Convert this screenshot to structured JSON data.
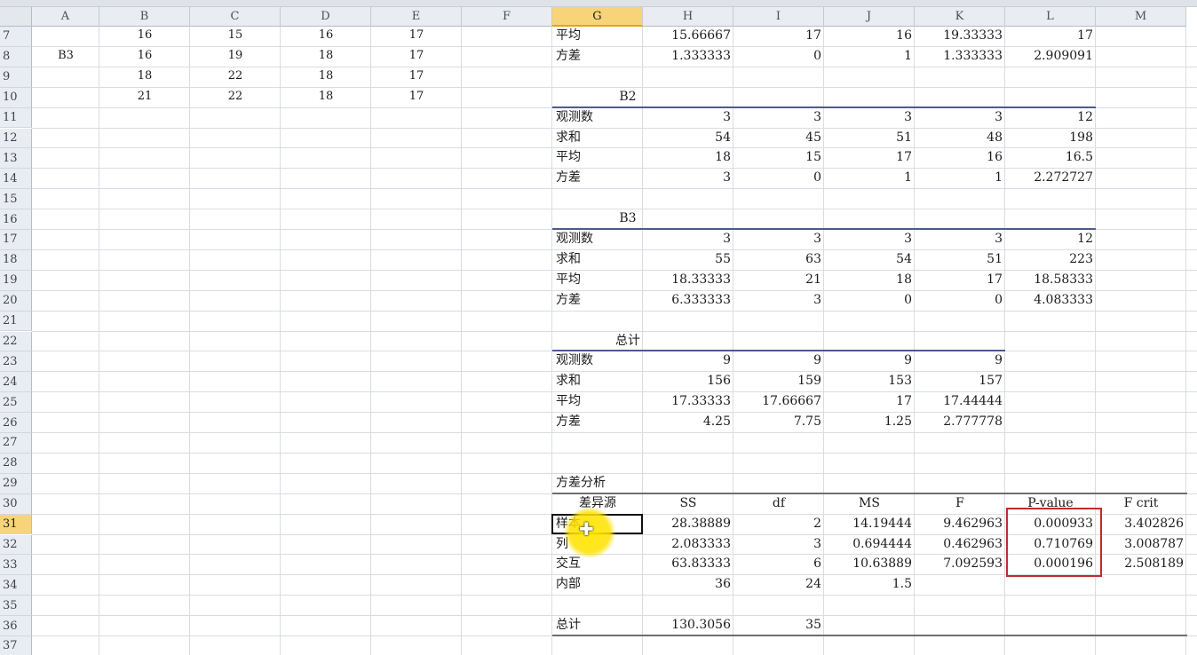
{
  "columns": [
    "A",
    "B",
    "C",
    "D",
    "E",
    "F",
    "G",
    "H",
    "I",
    "J",
    "K",
    "L",
    "M"
  ],
  "selected_column": "G",
  "rows": [
    "7",
    "8",
    "9",
    "10",
    "11",
    "12",
    "13",
    "14",
    "15",
    "16",
    "17",
    "18",
    "19",
    "20",
    "21",
    "22",
    "23",
    "24",
    "25",
    "26",
    "27",
    "28",
    "29",
    "30",
    "31",
    "32",
    "33",
    "34",
    "35",
    "36",
    "37"
  ],
  "selected_row": "31",
  "data_block": {
    "rows": [
      [
        "",
        "16",
        "15",
        "16",
        "17"
      ],
      [
        "B3",
        "16",
        "19",
        "18",
        "17"
      ],
      [
        "",
        "18",
        "22",
        "18",
        "17"
      ],
      [
        "",
        "21",
        "22",
        "18",
        "17"
      ]
    ]
  },
  "summary_top": {
    "rows": [
      [
        "平均",
        "15.66667",
        "17",
        "16",
        "19.33333",
        "17"
      ],
      [
        "方差",
        "1.333333",
        "0",
        "1",
        "1.333333",
        "2.909091"
      ]
    ]
  },
  "block_b2": {
    "title": "B2",
    "rows": [
      [
        "观测数",
        "3",
        "3",
        "3",
        "3",
        "12"
      ],
      [
        "求和",
        "54",
        "45",
        "51",
        "48",
        "198"
      ],
      [
        "平均",
        "18",
        "15",
        "17",
        "16",
        "16.5"
      ],
      [
        "方差",
        "3",
        "0",
        "1",
        "1",
        "2.272727"
      ]
    ]
  },
  "block_b3": {
    "title": "B3",
    "rows": [
      [
        "观测数",
        "3",
        "3",
        "3",
        "3",
        "12"
      ],
      [
        "求和",
        "55",
        "63",
        "54",
        "51",
        "223"
      ],
      [
        "平均",
        "18.33333",
        "21",
        "18",
        "17",
        "18.58333"
      ],
      [
        "方差",
        "6.333333",
        "3",
        "0",
        "0",
        "4.083333"
      ]
    ]
  },
  "block_total": {
    "title": "总计",
    "rows": [
      [
        "观测数",
        "9",
        "9",
        "9",
        "9"
      ],
      [
        "求和",
        "156",
        "159",
        "153",
        "157"
      ],
      [
        "平均",
        "17.33333",
        "17.66667",
        "17",
        "17.44444"
      ],
      [
        "方差",
        "4.25",
        "7.75",
        "1.25",
        "2.777778"
      ]
    ]
  },
  "anova": {
    "title": "方差分析",
    "headers": [
      "差异源",
      "SS",
      "df",
      "MS",
      "F",
      "P-value",
      "F crit"
    ],
    "rows": [
      [
        "样本",
        "28.38889",
        "2",
        "14.19444",
        "9.462963",
        "0.000933",
        "3.402826"
      ],
      [
        "列",
        "2.083333",
        "3",
        "0.694444",
        "0.462963",
        "0.710769",
        "3.008787"
      ],
      [
        "交互",
        "63.83333",
        "6",
        "10.63889",
        "7.092593",
        "0.000196",
        "2.508189"
      ],
      [
        "内部",
        "36",
        "24",
        "1.5",
        "",
        "",
        ""
      ]
    ],
    "total_row": [
      "总计",
      "130.3056",
      "35"
    ]
  },
  "colors": {
    "header_bg": "#e9ecf1",
    "selected_header": "#f8d478",
    "table_rule": "#4d5a8a",
    "highlight_box": "#c52a2a",
    "pointer_spot": "#ffe400"
  },
  "cursor_icon": "excel-cross-cursor"
}
